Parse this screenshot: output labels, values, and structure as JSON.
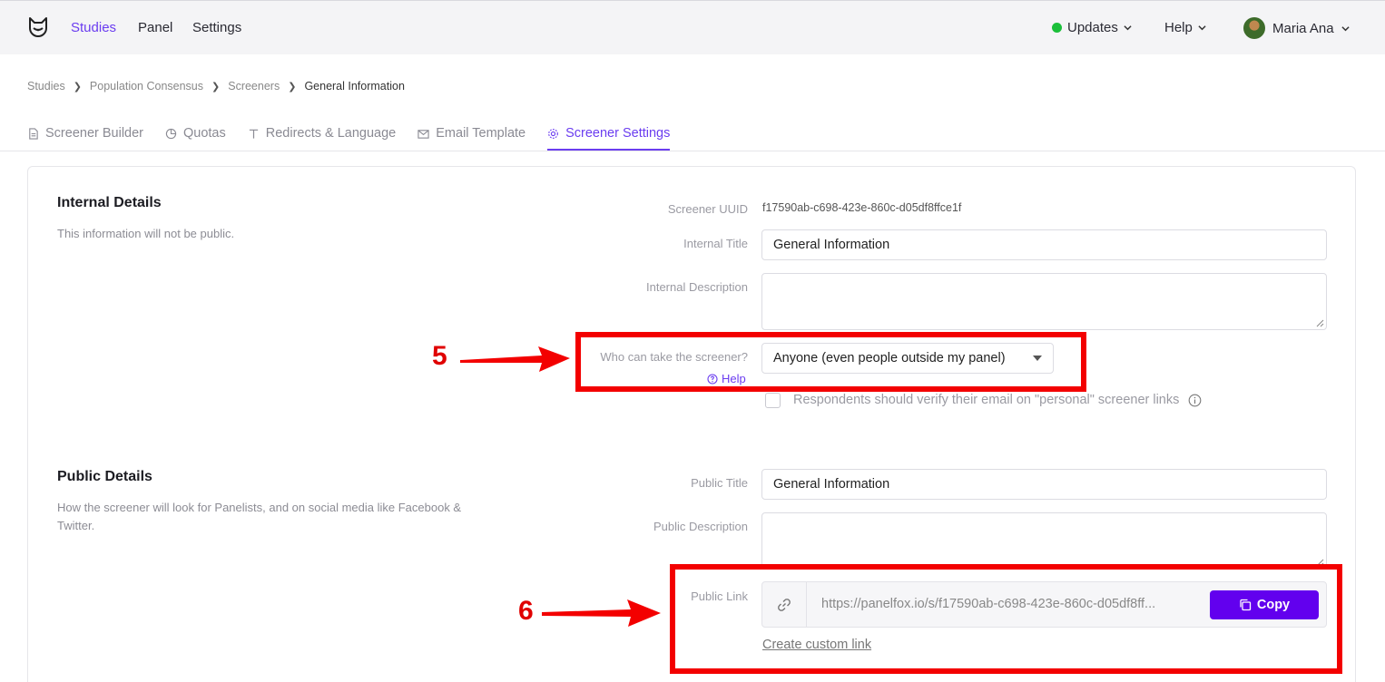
{
  "topnav": {
    "links": [
      "Studies",
      "Panel",
      "Settings"
    ],
    "updates_label": "Updates",
    "help_label": "Help",
    "user_name": "Maria Ana"
  },
  "breadcrumb": [
    "Studies",
    "Population Consensus",
    "Screeners",
    "General Information"
  ],
  "tabs": [
    "Screener Builder",
    "Quotas",
    "Redirects & Language",
    "Email Template",
    "Screener Settings"
  ],
  "internal": {
    "title": "Internal Details",
    "description": "This information will not be public.",
    "uuid_label": "Screener UUID",
    "uuid_value": "f17590ab-c698-423e-860c-d05df8ffce1f",
    "title_label": "Internal Title",
    "title_value": "General Information",
    "desc_label": "Internal Description",
    "desc_value": "",
    "who_label": "Who can take the screener?",
    "help_link": "Help",
    "who_value": "Anyone (even people outside my panel)",
    "verify_label": "Respondents should verify their email on \"personal\" screener links"
  },
  "public": {
    "title": "Public Details",
    "description": "How the screener will look for Panelists, and on social media like Facebook & Twitter.",
    "title_label": "Public Title",
    "title_value": "General Information",
    "desc_label": "Public Description",
    "desc_value": "",
    "link_label": "Public Link",
    "link_value": "https://panelfox.io/s/f17590ab-c698-423e-860c-d05df8ff...",
    "copy_label": "Copy",
    "custom_link_label": "Create custom link"
  },
  "annotations": [
    "5",
    "6"
  ],
  "colors": {
    "accent": "#6b3df0",
    "copy_button": "#6200ee",
    "annotation_red": "#f30000",
    "status_green": "#1bbf3a"
  }
}
